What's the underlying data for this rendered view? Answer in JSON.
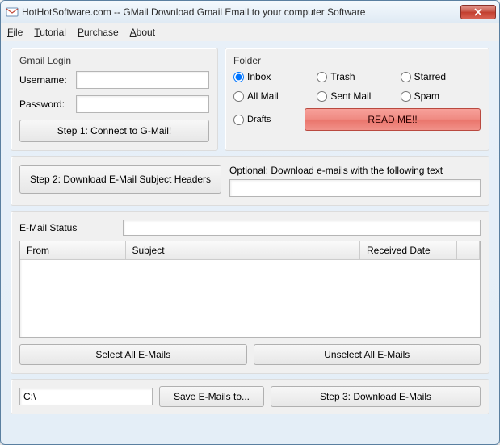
{
  "window": {
    "title": "HotHotSoftware.com -- GMail Download Gmail Email to your computer Software"
  },
  "menu": {
    "file": "File",
    "tutorial": "Tutorial",
    "purchase": "Purchase",
    "about": "About"
  },
  "login": {
    "legend": "Gmail Login",
    "username_label": "Username:",
    "password_label": "Password:",
    "username_value": "",
    "password_value": "",
    "connect_button": "Step 1: Connect to G-Mail!"
  },
  "folder": {
    "legend": "Folder",
    "inbox": "Inbox",
    "trash": "Trash",
    "starred": "Starred",
    "allmail": "All Mail",
    "sentmail": "Sent Mail",
    "spam": "Spam",
    "drafts": "Drafts",
    "selected": "inbox",
    "readme": "READ ME!!"
  },
  "step2": {
    "button": "Step 2: Download E-Mail Subject Headers",
    "optional_label": "Optional: Download e-mails with the following text",
    "optional_value": ""
  },
  "status": {
    "label": "E-Mail Status",
    "value": ""
  },
  "table": {
    "col_from": "From",
    "col_subject": "Subject",
    "col_received": "Received Date"
  },
  "select": {
    "all": "Select All E-Mails",
    "none": "Unselect All E-Mails"
  },
  "save": {
    "path": "C:\\",
    "button": "Save E-Mails to...",
    "step3": "Step 3: Download E-Mails"
  }
}
